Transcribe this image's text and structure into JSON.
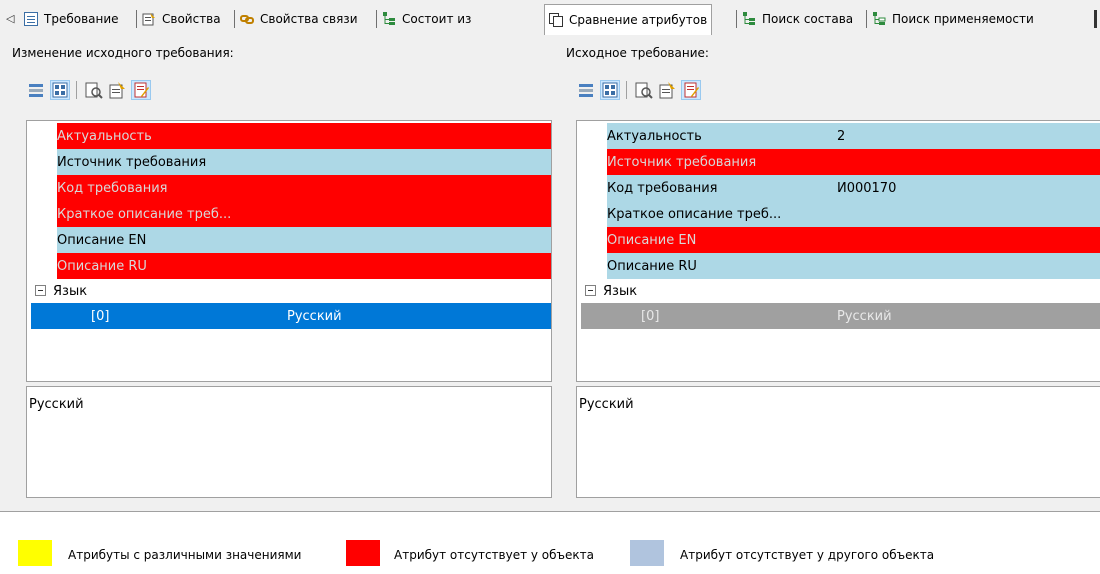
{
  "tabs": [
    {
      "label": "Требование",
      "icon": "form-icon"
    },
    {
      "label": "Свойства",
      "icon": "properties-icon"
    },
    {
      "label": "Свойства связи",
      "icon": "link-properties-icon"
    },
    {
      "label": "Состоит из",
      "icon": "tree-icon"
    },
    {
      "label": "Сравнение атрибутов",
      "icon": "compare-icon",
      "active": true
    },
    {
      "label": "Поиск состава",
      "icon": "tree-search-icon"
    },
    {
      "label": "Поиск применяемости",
      "icon": "tree-usage-icon"
    }
  ],
  "left": {
    "title": "Изменение исходного требования:",
    "rows": [
      {
        "name": "Актуальность",
        "value": "",
        "status": "red"
      },
      {
        "name": "Источник требования",
        "value": "",
        "status": "blue"
      },
      {
        "name": "Код требования",
        "value": "",
        "status": "red"
      },
      {
        "name": "Краткое описание треб...",
        "value": "",
        "status": "red"
      },
      {
        "name": "Описание EN",
        "value": "",
        "status": "blue"
      },
      {
        "name": "Описание RU",
        "value": "",
        "status": "red"
      }
    ],
    "group": {
      "name": "Язык",
      "child_index": "[0]",
      "child_value": "Русский"
    },
    "memo": "Русский"
  },
  "right": {
    "title": "Исходное требование:",
    "rows": [
      {
        "name": "Актуальность",
        "value": "2",
        "status": "blue"
      },
      {
        "name": "Источник требования",
        "value": "",
        "status": "red"
      },
      {
        "name": "Код требования",
        "value": "И000170",
        "status": "blue"
      },
      {
        "name": "Краткое описание треб...",
        "value": "",
        "status": "blue"
      },
      {
        "name": "Описание EN",
        "value": "",
        "status": "red"
      },
      {
        "name": "Описание RU",
        "value": "",
        "status": "blue"
      }
    ],
    "group": {
      "name": "Язык",
      "child_index": "[0]",
      "child_value": "Русский"
    },
    "memo": "Русский"
  },
  "legend": [
    {
      "color": "#ffff00",
      "text": "Атрибуты с различными значениями"
    },
    {
      "color": "#ff0000",
      "text": "Атрибут отсутствует у  объекта"
    },
    {
      "color": "#b0c4de",
      "text": "Атрибут отсутствует у другого объекта"
    }
  ],
  "colors": {
    "red": "#ff0000",
    "blue": "#add8e6",
    "selected": "#0078d7",
    "inactive_selected": "#a0a0a0"
  }
}
